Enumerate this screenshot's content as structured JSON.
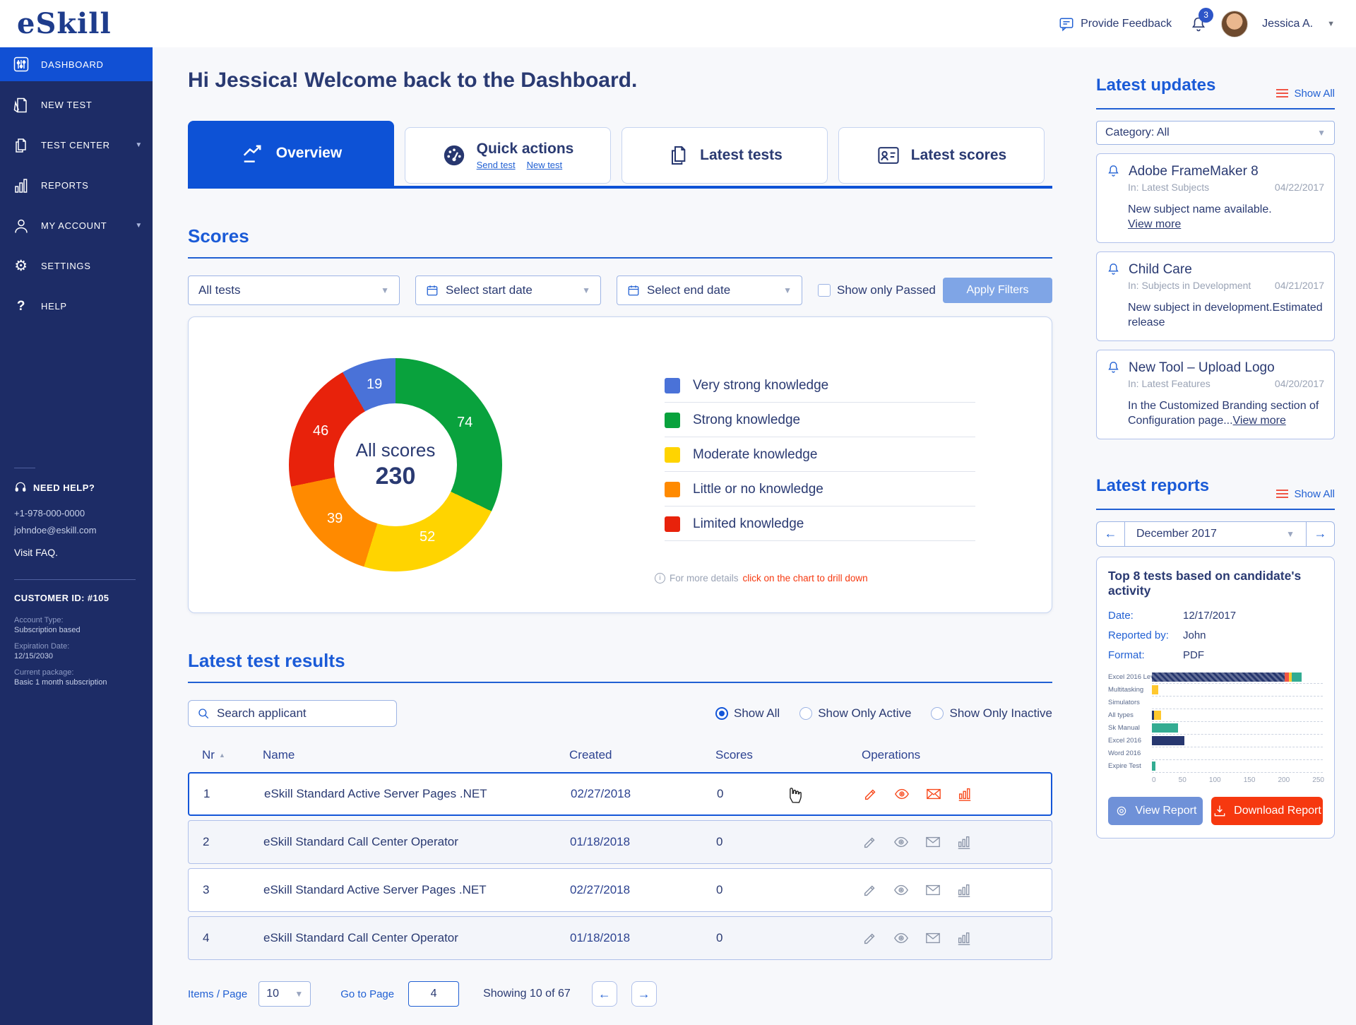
{
  "header": {
    "logo": "eSkill",
    "feedback_label": "Provide Feedback",
    "notification_count": "3",
    "user_name": "Jessica A."
  },
  "sidebar": {
    "items": [
      {
        "label": "DASHBOARD"
      },
      {
        "label": "NEW TEST"
      },
      {
        "label": "TEST CENTER"
      },
      {
        "label": "REPORTS"
      },
      {
        "label": "MY ACCOUNT"
      },
      {
        "label": "SETTINGS"
      },
      {
        "label": "HELP"
      }
    ],
    "help_block": {
      "title": "NEED HELP?",
      "phone": "+1-978-000-0000",
      "email": "johndoe@eskill.com",
      "faq": "Visit FAQ."
    },
    "customer_block": {
      "id": "CUSTOMER ID: #105",
      "account_type_label": "Account Type:",
      "account_type_value": "Subscription based",
      "expiration_label": "Expiration Date:",
      "expiration_value": "12/15/2030",
      "package_label": "Current package:",
      "package_value": "Basic 1 month subscription"
    }
  },
  "main": {
    "greeting": "Hi Jessica! Welcome back to the Dashboard.",
    "tabs": [
      {
        "label": "Overview"
      },
      {
        "label": "Quick actions",
        "link1": "Send test",
        "link2": "New test"
      },
      {
        "label": "Latest tests"
      },
      {
        "label": "Latest scores"
      }
    ],
    "scores_section": {
      "title": "Scores",
      "filter_tests": "All tests",
      "filter_start": "Select start date",
      "filter_end": "Select end date",
      "filter_passed": "Show only Passed",
      "apply_button": "Apply Filters",
      "note_prefix": "For more details",
      "note_link": "click on the chart to drill down"
    },
    "results": {
      "title": "Latest test results",
      "search_placeholder": "Search applicant",
      "radio_all": "Show All",
      "radio_active": "Show Only Active",
      "radio_inactive": "Show Only Inactive",
      "headers": {
        "nr": "Nr",
        "name": "Name",
        "created": "Created",
        "scores": "Scores",
        "operations": "Operations"
      },
      "rows": [
        {
          "nr": "1",
          "name": "eSkill Standard Active Server Pages .NET",
          "created": "02/27/2018",
          "score": "0"
        },
        {
          "nr": "2",
          "name": "eSkill Standard Call Center Operator",
          "created": "01/18/2018",
          "score": "0"
        },
        {
          "nr": "3",
          "name": "eSkill Standard Active Server Pages .NET",
          "created": "02/27/2018",
          "score": "0"
        },
        {
          "nr": "4",
          "name": "eSkill Standard Call Center Operator",
          "created": "01/18/2018",
          "score": "0"
        }
      ],
      "pagination": {
        "items_label": "Items / Page",
        "items_value": "10",
        "goto_label": "Go to Page",
        "goto_value": "4",
        "showing": "Showing 10 of 67"
      }
    }
  },
  "updates_panel": {
    "title": "Latest updates",
    "show_all": "Show All",
    "category_filter": "Category: All",
    "cards": [
      {
        "title": "Adobe FrameMaker 8",
        "in": "In: Latest Subjects",
        "date": "04/22/2017",
        "body": "New subject name available.",
        "link": "View more"
      },
      {
        "title": "Child Care",
        "in": "In: Subjects in Development",
        "date": "04/21/2017",
        "body": "New subject in development.Estimated release"
      },
      {
        "title": "New Tool – Upload Logo",
        "in": "In: Latest Features",
        "date": "04/20/2017",
        "body": "In the Customized Branding section of Configuration page...",
        "link": "View more"
      }
    ]
  },
  "reports_panel": {
    "title": "Latest reports",
    "show_all": "Show All",
    "month": "December 2017",
    "card_title": "Top 8 tests based on candidate's activity",
    "date_label": "Date:",
    "date_value": "12/17/2017",
    "reported_label": "Reported by:",
    "reported_value": "John",
    "format_label": "Format:",
    "format_value": "PDF",
    "view_button": "View Report",
    "download_button": "Download Report"
  },
  "chart_data": [
    {
      "type": "pie",
      "subtype": "donut",
      "center_label": "All scores",
      "center_value": 230,
      "total": 230,
      "slices": [
        {
          "label": "Strong knowledge",
          "value": 74,
          "color": "#09a23d"
        },
        {
          "label": "Moderate knowledge",
          "value": 52,
          "color": "#ffd400"
        },
        {
          "label": "Little or no knowledge",
          "value": 39,
          "color": "#ff8a00"
        },
        {
          "label": "Limited knowledge",
          "value": 46,
          "color": "#e8220b"
        },
        {
          "label": "Very strong knowledge",
          "value": 19,
          "color": "#4a72d8"
        }
      ],
      "legend": [
        {
          "label": "Very strong knowledge",
          "color": "#4a72d8"
        },
        {
          "label": "Strong knowledge",
          "color": "#09a23d"
        },
        {
          "label": "Moderate knowledge",
          "color": "#ffd400"
        },
        {
          "label": "Little or no knowledge",
          "color": "#ff8a00"
        },
        {
          "label": "Limited knowledge",
          "color": "#e8220b"
        }
      ],
      "legend_position": "right",
      "note": "For more details click on the chart to drill down"
    },
    {
      "type": "bar",
      "orientation": "horizontal",
      "stacked": true,
      "title": "Top 8 tests based on candidate's activity",
      "xlim": [
        0,
        250
      ],
      "xticks": [
        0,
        50,
        100,
        150,
        200,
        250
      ],
      "grid": "dashed-row-lines",
      "rows": [
        {
          "label": "Excel 2016 Levi",
          "segments": [
            {
              "value": 193,
              "color": "#27376f",
              "hatch": true
            },
            {
              "value": 6,
              "color": "#f05545"
            },
            {
              "value": 4,
              "color": "#ffc82e"
            },
            {
              "value": 15,
              "color": "#33ac92"
            }
          ]
        },
        {
          "label": "Multitasking",
          "segments": [
            {
              "value": 10,
              "color": "#ffc82e"
            }
          ]
        },
        {
          "label": "Simulators",
          "segments": []
        },
        {
          "label": "All types",
          "segments": [
            {
              "value": 3,
              "color": "#27376f"
            },
            {
              "value": 11,
              "color": "#ffc82e"
            }
          ]
        },
        {
          "label": "Sk Manual",
          "segments": [
            {
              "value": 38,
              "color": "#33ac92"
            }
          ]
        },
        {
          "label": "Excel 2016",
          "segments": [
            {
              "value": 48,
              "color": "#27376f"
            }
          ]
        },
        {
          "label": "Word 2016",
          "segments": []
        },
        {
          "label": "Expire Test",
          "segments": [
            {
              "value": 6,
              "color": "#33ac92"
            }
          ]
        }
      ]
    }
  ]
}
